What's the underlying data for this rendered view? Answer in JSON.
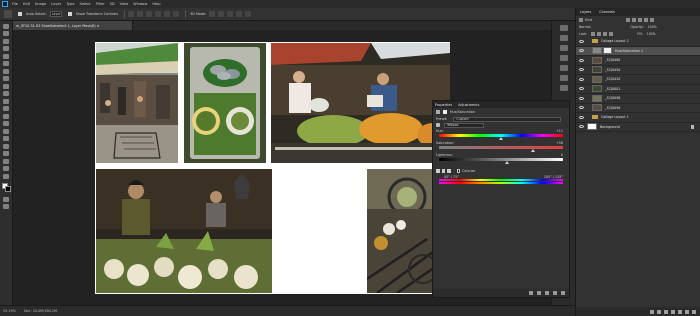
{
  "menu": [
    "File",
    "Edit",
    "Image",
    "Layer",
    "Type",
    "Select",
    "Filter",
    "3D",
    "View",
    "Window",
    "Help"
  ],
  "options_bar": {
    "auto_select_label": "Auto-Select:",
    "auto_select_value": "Layer",
    "show_transform_label": "Show Transform Controls",
    "mode_3d_label": "3D Mode:"
  },
  "document": {
    "tab_title": "m_SF20 31-05 ShoeSubselect 1, Layer Mask/8) ×",
    "zoom": "25.19%",
    "doc_size": "Doc: 24.0M/180.2M"
  },
  "properties_panel": {
    "tabs": [
      "Properties",
      "Adjustments"
    ],
    "header": "Hue/Saturation",
    "preset_label": "Preset:",
    "preset_value": "Custom",
    "channel_value": "Yellows",
    "hue_label": "Hue:",
    "hue_value": "+11",
    "saturation_label": "Saturation:",
    "saturation_value": "+58",
    "lightness_label": "Lightness:",
    "lightness_value": "0",
    "colorize_label": "Colorize",
    "range_left": "45° / 75°",
    "range_right": "105° \\ 135°"
  },
  "layers_panel": {
    "tabs": [
      "Layers",
      "Channels"
    ],
    "kind_label": "Kind",
    "blend_mode": "Normal",
    "opacity_label": "Opacity:",
    "opacity_value": "100%",
    "lock_label": "Lock:",
    "fill_label": "Fill:",
    "fill_value": "100%",
    "layers": [
      {
        "name": "Collage Layout 2",
        "type": "group",
        "visible": true,
        "selected": false
      },
      {
        "name": "Hue/Saturation 1",
        "type": "adjustment",
        "visible": true,
        "selected": true
      },
      {
        "name": "_SCJ0480",
        "type": "image",
        "visible": true,
        "selected": false
      },
      {
        "name": "_SCJ0450",
        "type": "image",
        "visible": true,
        "selected": false
      },
      {
        "name": "_SCJ0420",
        "type": "image",
        "visible": true,
        "selected": false
      },
      {
        "name": "_SCJ0001",
        "type": "image",
        "visible": true,
        "selected": false
      },
      {
        "name": "_SCJ0098",
        "type": "image",
        "visible": true,
        "selected": false
      },
      {
        "name": "_SCJ0090",
        "type": "image",
        "visible": true,
        "selected": false
      },
      {
        "name": "Collage Layout 1",
        "type": "group",
        "visible": true,
        "selected": false
      },
      {
        "name": "Background",
        "type": "background",
        "visible": true,
        "selected": false
      }
    ]
  },
  "colors": {
    "accent": "#31a8ff",
    "panel_bg": "#323232",
    "canvas_bg": "#222222"
  }
}
